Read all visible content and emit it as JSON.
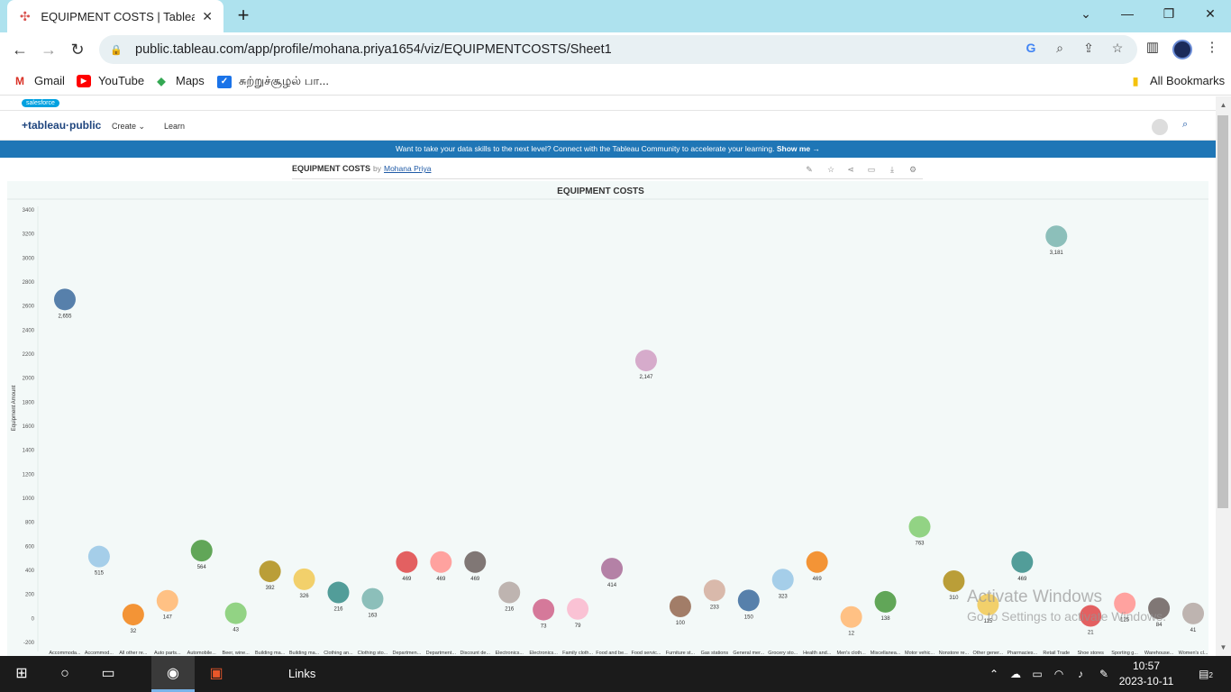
{
  "browser": {
    "tab_title": "EQUIPMENT COSTS | Tableau Pu",
    "url": "public.tableau.com/app/profile/mohana.priya1654/viz/EQUIPMENTCOSTS/Sheet1",
    "bookmarks": [
      "Gmail",
      "YouTube",
      "Maps",
      "சுற்றுச்சூழல் பா...",
      "All Bookmarks"
    ]
  },
  "site": {
    "salesforce": "salesforce",
    "logo": "+tableau·public",
    "nav": [
      "Create",
      "Learn"
    ],
    "banner_text": "Want to take your data skills to the next level? Connect with the Tableau Community to accelerate your learning.",
    "banner_link": "Show me →",
    "viz_title": "EQUIPMENT COSTS",
    "viz_by": "by",
    "viz_author": "Mohana Priya"
  },
  "chart_data": {
    "type": "scatter",
    "title": "EQUIPMENT COSTS",
    "ylabel": "Equipment Amount",
    "xlabel": "",
    "ylim": [
      -200,
      3400
    ],
    "yticks": [
      -200,
      0,
      200,
      400,
      600,
      800,
      1000,
      1200,
      1400,
      1600,
      1800,
      2000,
      2200,
      2400,
      2600,
      2800,
      3000,
      3200,
      3400
    ],
    "grid": false,
    "points": [
      {
        "category": "Accommoda...",
        "value": 2655,
        "label": "2,655",
        "color": "#4e79a7"
      },
      {
        "category": "Accommod...",
        "value": 515,
        "label": "515",
        "color": "#a0cbe8"
      },
      {
        "category": "All other re...",
        "value": 32,
        "label": "32",
        "color": "#f28e2b"
      },
      {
        "category": "Auto parts...",
        "value": 147,
        "label": "147",
        "color": "#ffbe7d"
      },
      {
        "category": "Automobile...",
        "value": 564,
        "label": "564",
        "color": "#59a14f"
      },
      {
        "category": "Beer, wine...",
        "value": 43,
        "label": "43",
        "color": "#8cd17d"
      },
      {
        "category": "Building ma...",
        "value": 392,
        "label": "392",
        "color": "#b6992d"
      },
      {
        "category": "Building ma...",
        "value": 326,
        "label": "326",
        "color": "#f1ce63"
      },
      {
        "category": "Clothing an...",
        "value": 216,
        "label": "216",
        "color": "#499894"
      },
      {
        "category": "Clothing sto...",
        "value": 163,
        "label": "163",
        "color": "#86bcb6"
      },
      {
        "category": "Departmen...",
        "value": 469,
        "label": "469",
        "color": "#e15759"
      },
      {
        "category": "Department...",
        "value": 469,
        "label": "469",
        "color": "#ff9d9a"
      },
      {
        "category": "Discount de...",
        "value": 469,
        "label": "469",
        "color": "#79706e"
      },
      {
        "category": "Electronics...",
        "value": 216,
        "label": "216",
        "color": "#bab0ac"
      },
      {
        "category": "Electronics...",
        "value": 73,
        "label": "73",
        "color": "#d37295"
      },
      {
        "category": "Family cloth...",
        "value": 79,
        "label": "79",
        "color": "#fabfd2"
      },
      {
        "category": "Food and be...",
        "value": 414,
        "label": "414",
        "color": "#b07aa1"
      },
      {
        "category": "Food servic...",
        "value": 2147,
        "label": "2,147",
        "color": "#d4a6c8"
      },
      {
        "category": "Furniture st...",
        "value": 100,
        "label": "100",
        "color": "#9d7660"
      },
      {
        "category": "Gas stations",
        "value": 233,
        "label": "233",
        "color": "#d7b5a6"
      },
      {
        "category": "General mer...",
        "value": 150,
        "label": "150",
        "color": "#4e79a7"
      },
      {
        "category": "Grocery sto...",
        "value": 323,
        "label": "323",
        "color": "#a0cbe8"
      },
      {
        "category": "Health and...",
        "value": 469,
        "label": "469",
        "color": "#f28e2b"
      },
      {
        "category": "Men's cloth...",
        "value": 12,
        "label": "12",
        "color": "#ffbe7d"
      },
      {
        "category": "Miscellanea...",
        "value": 138,
        "label": "138",
        "color": "#59a14f"
      },
      {
        "category": "Motor vehic...",
        "value": 763,
        "label": "763",
        "color": "#8cd17d"
      },
      {
        "category": "Nonstore re...",
        "value": 310,
        "label": "310",
        "color": "#b6992d"
      },
      {
        "category": "Other gener...",
        "value": 115,
        "label": "115",
        "color": "#f1ce63"
      },
      {
        "category": "Pharmacies...",
        "value": 469,
        "label": "469",
        "color": "#499894"
      },
      {
        "category": "Retail Trade",
        "value": 3181,
        "label": "3,181",
        "color": "#86bcb6"
      },
      {
        "category": "Shoe stores",
        "value": 21,
        "label": "21",
        "color": "#e15759"
      },
      {
        "category": "Sporting g...",
        "value": 125,
        "label": "125",
        "color": "#ff9d9a"
      },
      {
        "category": "Warehouse...",
        "value": 84,
        "label": "84",
        "color": "#79706e"
      },
      {
        "category": "Women's cl...",
        "value": 41,
        "label": "41",
        "color": "#bab0ac"
      }
    ]
  },
  "watermark": {
    "line1": "Activate Windows",
    "line2": "Go to Settings to activate Windows."
  },
  "taskbar": {
    "links": "Links",
    "time": "10:57",
    "date": "2023-10-11",
    "notification_count": "2"
  }
}
